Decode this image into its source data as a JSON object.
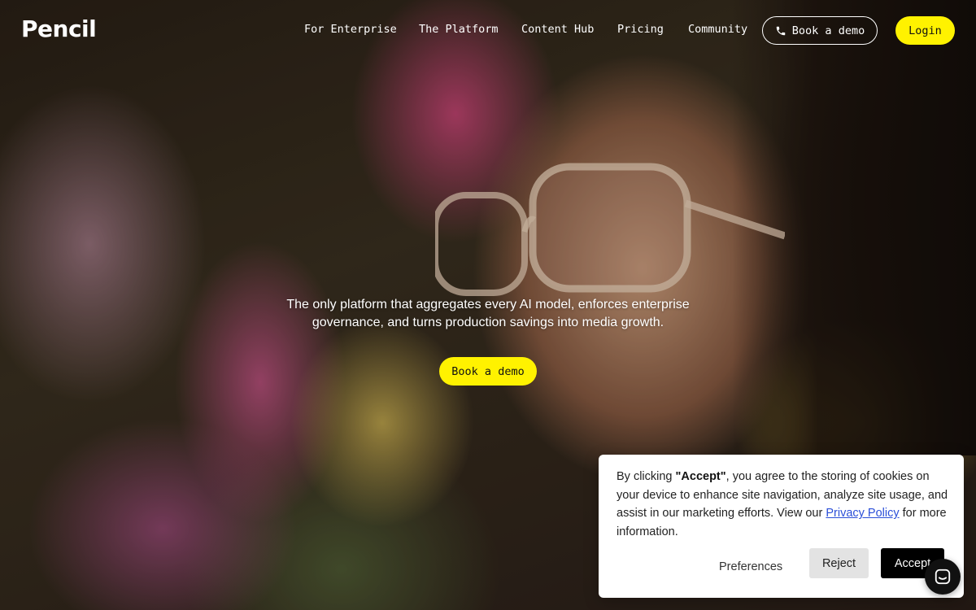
{
  "brand": {
    "name": "Pencil",
    "accent_color": "#fff200"
  },
  "nav": {
    "items": [
      {
        "label": "For Enterprise"
      },
      {
        "label": "The Platform"
      },
      {
        "label": "Content Hub"
      },
      {
        "label": "Pricing"
      },
      {
        "label": "Community"
      }
    ],
    "book_demo_label": "Book a demo",
    "book_demo_icon": "phone-icon",
    "login_label": "Login"
  },
  "hero": {
    "line1": "The only platform that aggregates every AI model, enforces enterprise",
    "line2": "governance, and turns production savings into media growth.",
    "cta_label": "Book a demo"
  },
  "cookie_banner": {
    "text_before": "By clicking ",
    "text_bold": "\"Accept\"",
    "text_middle": ", you agree to the storing of cookies on your device to enhance site navigation, analyze site usage, and assist in our marketing efforts. View our ",
    "link_label": "Privacy Policy",
    "text_after": " for more information.",
    "preferences_label": "Preferences",
    "reject_label": "Reject",
    "accept_label": "Accept"
  },
  "chat_widget": {
    "icon": "chat-icon"
  }
}
